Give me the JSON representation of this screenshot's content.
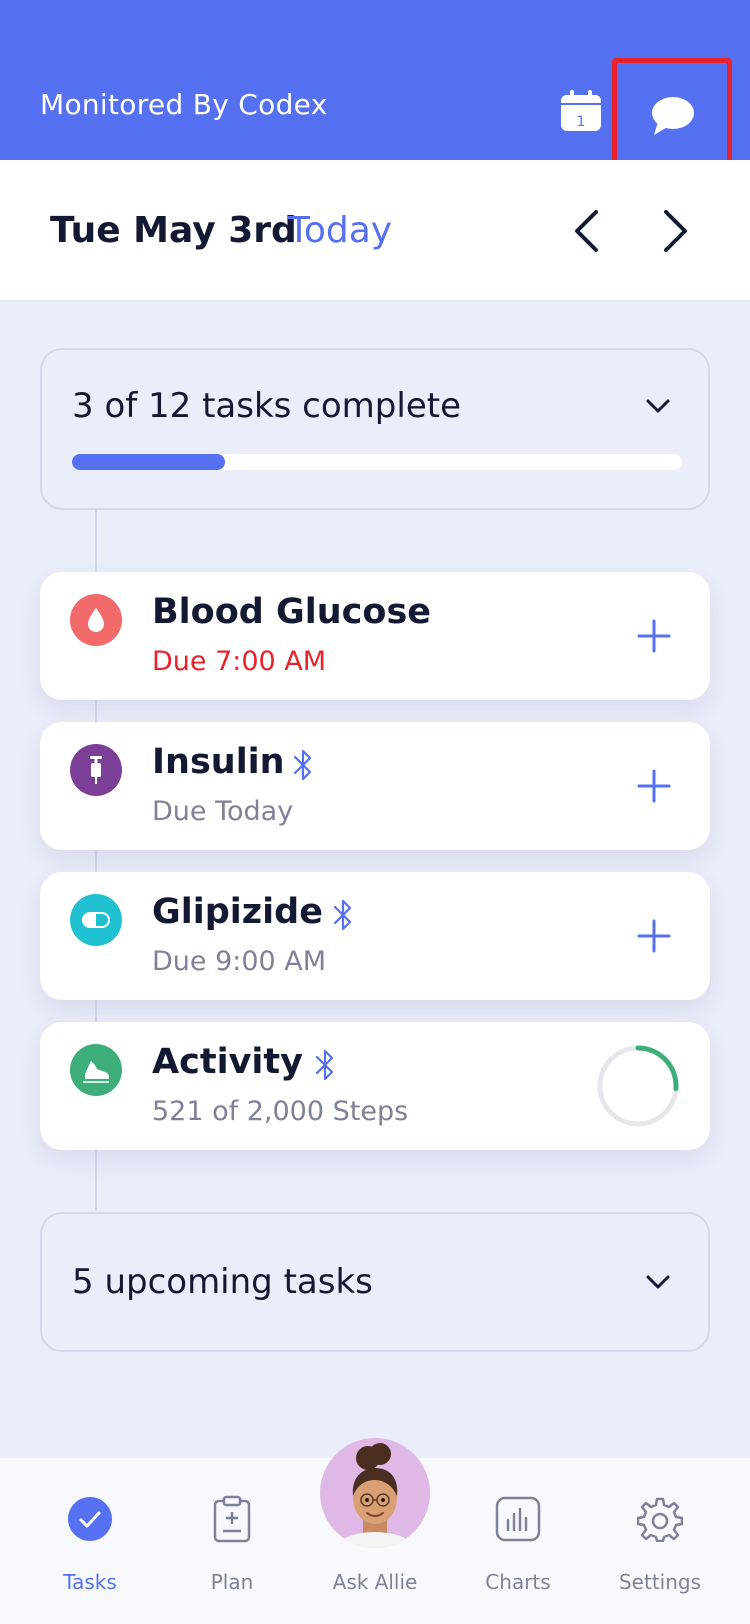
{
  "header": {
    "title": "Monitored By Codex",
    "calendar_day": "1",
    "accent_color": "#5570F1",
    "highlight_color": "#E8232B"
  },
  "datebar": {
    "date": "Tue May 3rd",
    "today_label": "Today"
  },
  "summary": {
    "text": "3 of 12 tasks complete",
    "completed": 3,
    "total": 12
  },
  "tasks": [
    {
      "name": "Blood Glucose",
      "status": "Due 7:00 AM",
      "icon": "blood-drop-icon",
      "icon_color": "#F26A6A",
      "bluetooth": false,
      "action": "add"
    },
    {
      "name": "Insulin",
      "status": "Due Today",
      "icon": "syringe-icon",
      "icon_color": "#7B3F98",
      "bluetooth": true,
      "action": "add"
    },
    {
      "name": "Glipizide",
      "status": "Due 9:00 AM",
      "icon": "pill-icon",
      "icon_color": "#1FC1D0",
      "bluetooth": true,
      "action": "add"
    },
    {
      "name": "Activity",
      "status": "521 of 2,000 Steps",
      "icon": "shoe-icon",
      "icon_color": "#3DAE7A",
      "bluetooth": true,
      "action": "progress-ring",
      "steps": 521,
      "steps_goal": 2000
    }
  ],
  "upcoming": {
    "text": "5 upcoming tasks"
  },
  "tabbar": {
    "items": [
      {
        "label": "Tasks",
        "icon": "check-circle-icon",
        "active": true
      },
      {
        "label": "Plan",
        "icon": "clipboard-icon",
        "active": false
      },
      {
        "label": "Ask Allie",
        "icon": "avatar-icon",
        "active": false
      },
      {
        "label": "Charts",
        "icon": "bar-chart-icon",
        "active": false
      },
      {
        "label": "Settings",
        "icon": "gear-icon",
        "active": false
      }
    ]
  }
}
